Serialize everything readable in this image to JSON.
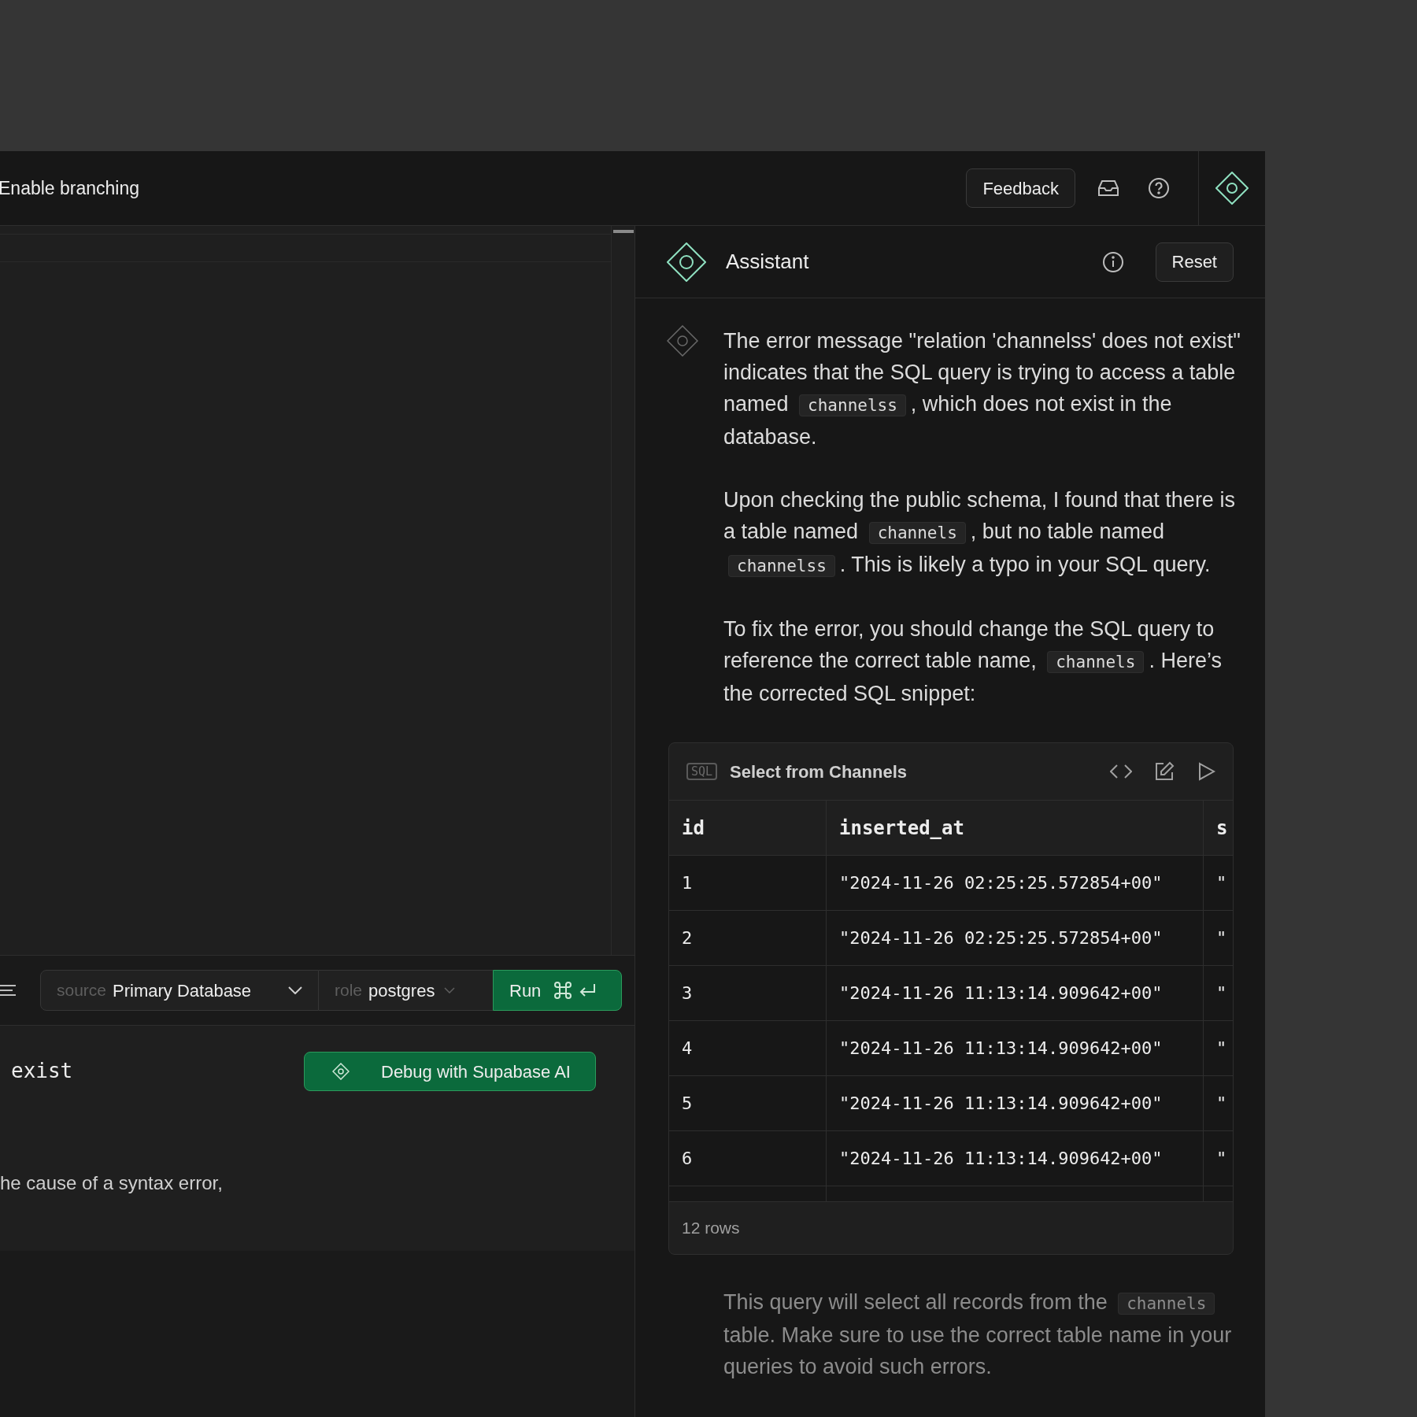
{
  "top_bar": {
    "title": "Enable branching",
    "feedback_button": "Feedback"
  },
  "editor": {
    "toolbar": {
      "source_label": "source",
      "source_value": "Primary Database",
      "role_label": "role",
      "role_value": "postgres",
      "run_button": "Run"
    }
  },
  "results": {
    "error_text": "exist",
    "debug_button": "Debug with Supabase AI",
    "hint_text": "he cause of a syntax error,"
  },
  "assistant": {
    "title": "Assistant",
    "reset_button": "Reset",
    "message_before": [
      [
        {
          "kind": "text",
          "text": "The error message \"relation 'channelss' does not exist\" indicates that the SQL query is trying to access a table named "
        },
        {
          "kind": "code",
          "text": "channelss"
        },
        {
          "kind": "text",
          "text": ", which does not exist in the database."
        }
      ],
      [
        {
          "kind": "text",
          "text": "Upon checking the public schema, I found that there is a table named "
        },
        {
          "kind": "code",
          "text": "channels"
        },
        {
          "kind": "text",
          "text": ", but no table named "
        },
        {
          "kind": "code",
          "text": "channelss"
        },
        {
          "kind": "text",
          "text": ". This is likely a typo in your SQL query."
        }
      ],
      [
        {
          "kind": "text",
          "text": "To fix the error, you should change the SQL query to reference the correct table name, "
        },
        {
          "kind": "code",
          "text": "channels"
        },
        {
          "kind": "text",
          "text": ". Here’s the corrected SQL snippet:"
        }
      ]
    ],
    "snippet": {
      "badge": "SQL",
      "title": "Select from Channels",
      "columns": [
        "id",
        "inserted_at",
        "s"
      ],
      "rows": [
        [
          "1",
          "\"2024-11-26 02:25:25.572854+00\"",
          "\""
        ],
        [
          "2",
          "\"2024-11-26 02:25:25.572854+00\"",
          "\""
        ],
        [
          "3",
          "\"2024-11-26 11:13:14.909642+00\"",
          "\""
        ],
        [
          "4",
          "\"2024-11-26 11:13:14.909642+00\"",
          "\""
        ],
        [
          "5",
          "\"2024-11-26 11:13:14.909642+00\"",
          "\""
        ],
        [
          "6",
          "\"2024-11-26 11:13:14.909642+00\"",
          "\""
        ]
      ],
      "row_count": "12 rows"
    },
    "message_after": [
      [
        {
          "kind": "text",
          "text": "This query will select all records from the "
        },
        {
          "kind": "code",
          "text": "channels"
        },
        {
          "kind": "text",
          "text": " table. Make sure to use the correct table name in your queries to avoid such errors."
        }
      ]
    ]
  }
}
